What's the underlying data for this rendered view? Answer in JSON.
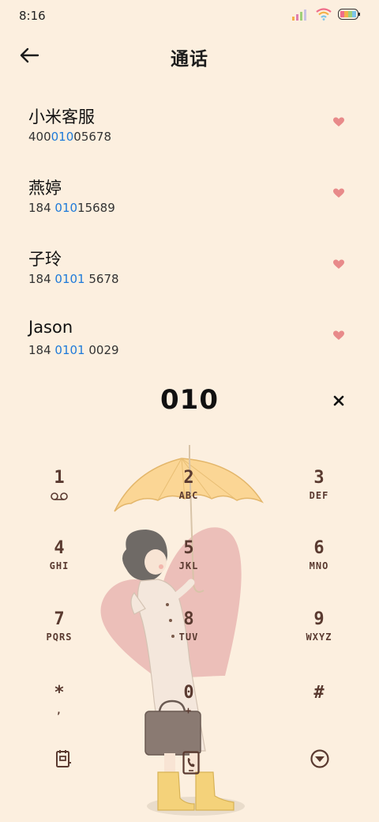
{
  "status_bar": {
    "time": "8:16"
  },
  "header": {
    "title": "通话"
  },
  "contacts": [
    {
      "name": "小米客服",
      "number_parts": [
        "400",
        "010",
        "05678"
      ]
    },
    {
      "name": "燕婷",
      "number_parts": [
        "184 ",
        "010",
        "15689"
      ]
    },
    {
      "name": "子玲",
      "number_parts": [
        "184 ",
        "0101",
        " 5678"
      ]
    },
    {
      "name": "Jason",
      "number_parts": [
        "184 ",
        "0101",
        " 0029"
      ]
    }
  ],
  "dialer": {
    "number": "010"
  },
  "keypad": [
    {
      "digit": "1",
      "letters": ""
    },
    {
      "digit": "2",
      "letters": "ABC"
    },
    {
      "digit": "3",
      "letters": "DEF"
    },
    {
      "digit": "4",
      "letters": "GHI"
    },
    {
      "digit": "5",
      "letters": "JKL"
    },
    {
      "digit": "6",
      "letters": "MNO"
    },
    {
      "digit": "7",
      "letters": "PQRS"
    },
    {
      "digit": "8",
      "letters": "TUV"
    },
    {
      "digit": "9",
      "letters": "WXYZ"
    },
    {
      "digit": "*",
      "letters": ","
    },
    {
      "digit": "0",
      "letters": "+"
    },
    {
      "digit": "#",
      "letters": ""
    }
  ],
  "colors": {
    "highlight": "#1e7ad9",
    "heart": "#e88a8a",
    "keypad_text": "#5a3a30",
    "background": "#fcefdf"
  },
  "icons": {
    "back": "arrow-left-icon",
    "heart": "heart-icon",
    "clear": "close-icon",
    "voicemail": "voicemail-icon",
    "contacts": "contacts-book-icon",
    "call": "phone-call-icon",
    "collapse": "collapse-keypad-icon"
  }
}
